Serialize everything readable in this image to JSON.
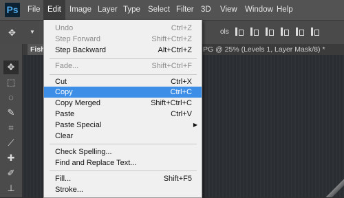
{
  "app": {
    "logo": "Ps"
  },
  "menubar": [
    {
      "label": "File"
    },
    {
      "label": "Edit"
    },
    {
      "label": "Image"
    },
    {
      "label": "Layer"
    },
    {
      "label": "Type"
    },
    {
      "label": "Select"
    },
    {
      "label": "Filter"
    },
    {
      "label": "3D"
    },
    {
      "label": "View"
    },
    {
      "label": "Window"
    },
    {
      "label": "Help"
    }
  ],
  "options": {
    "truncated_text": "ols"
  },
  "tabs": {
    "left": "Fishi",
    "right": "PG @ 25% (Levels 1, Layer Mask/8) *"
  },
  "edit_menu": {
    "items": [
      {
        "label": "Undo",
        "shortcut": "Ctrl+Z",
        "disabled": true
      },
      {
        "label": "Step Forward",
        "shortcut": "Shift+Ctrl+Z",
        "disabled": true
      },
      {
        "label": "Step Backward",
        "shortcut": "Alt+Ctrl+Z"
      },
      {
        "label": "Fade...",
        "shortcut": "Shift+Ctrl+F",
        "disabled": true
      },
      {
        "label": "Cut",
        "shortcut": "Ctrl+X"
      },
      {
        "label": "Copy",
        "shortcut": "Ctrl+C",
        "highlighted": true
      },
      {
        "label": "Copy Merged",
        "shortcut": "Shift+Ctrl+C"
      },
      {
        "label": "Paste",
        "shortcut": "Ctrl+V"
      },
      {
        "label": "Paste Special",
        "shortcut": "",
        "submenu": true
      },
      {
        "label": "Clear",
        "shortcut": ""
      },
      {
        "label": "Check Spelling...",
        "shortcut": ""
      },
      {
        "label": "Find and Replace Text...",
        "shortcut": ""
      },
      {
        "label": "Fill...",
        "shortcut": "Shift+F5"
      },
      {
        "label": "Stroke...",
        "shortcut": ""
      }
    ]
  },
  "colors": {
    "highlight": "#3d8ee6",
    "menubar": "#535353",
    "menu_bg": "#f0f0f0"
  }
}
